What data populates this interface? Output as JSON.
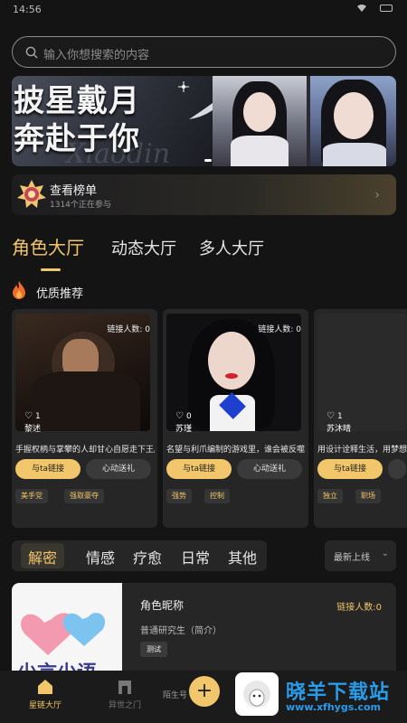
{
  "status": {
    "time": "14:56"
  },
  "search": {
    "placeholder": "输入你想搜索的内容"
  },
  "banner": {
    "line1": "披星戴月",
    "line2": "奔赴于你"
  },
  "rank": {
    "label": "查看榜单",
    "sub": "1314个正在参与",
    "arrow": "›"
  },
  "tabs": [
    {
      "label": "角色大厅",
      "active": true
    },
    {
      "label": "动态大厅",
      "active": false
    },
    {
      "label": "多人大厅",
      "active": false
    }
  ],
  "section": {
    "title": "优质推荐"
  },
  "cards": [
    {
      "links": "链接人数: 0",
      "likes": "1",
      "name": "黎述",
      "desc": "手握权柄与掌攀的人却甘心自愿走下王座",
      "link_btn": "与ta链接",
      "gift_btn": "心动送礼",
      "tags": [
        "美手党",
        "强取豪夺"
      ]
    },
    {
      "links": "链接人数: 0",
      "likes": "0",
      "name": "苏瑾",
      "desc": "名望与利爪编制的游戏里，谁会被反噬",
      "link_btn": "与ta链接",
      "gift_btn": "心动送礼",
      "tags": [
        "强势",
        "控制"
      ]
    },
    {
      "links": "",
      "likes": "1",
      "name": "苏沐晴",
      "desc": "用设计诠释生活，用梦想",
      "link_btn": "与ta链接",
      "gift_btn": "",
      "tags": [
        "独立",
        "职场"
      ]
    }
  ],
  "categories": [
    {
      "label": "解密",
      "active": true
    },
    {
      "label": "情感",
      "active": false
    },
    {
      "label": "疗愈",
      "active": false
    },
    {
      "label": "日常",
      "active": false
    },
    {
      "label": "其他",
      "active": false
    }
  ],
  "sort": {
    "label": "最新上线",
    "icon": "chevron-down-icon"
  },
  "list_item": {
    "name": "角色昵称",
    "links": "链接人数:0",
    "intro": "普通研究生（简介）",
    "tag": "测试",
    "avatar_text": "少言少语"
  },
  "bottom_nav": {
    "home_label": "星链大厅",
    "world_label": "异世之门",
    "partial_label": "陌生号",
    "fab": "+"
  },
  "watermark": {
    "big": "晓羊下载站",
    "url": "www.xfhygs.com"
  },
  "colors": {
    "accent": "#f2c66a",
    "background": "#141414",
    "card": "#262626",
    "watermark": "#2a9be8"
  }
}
